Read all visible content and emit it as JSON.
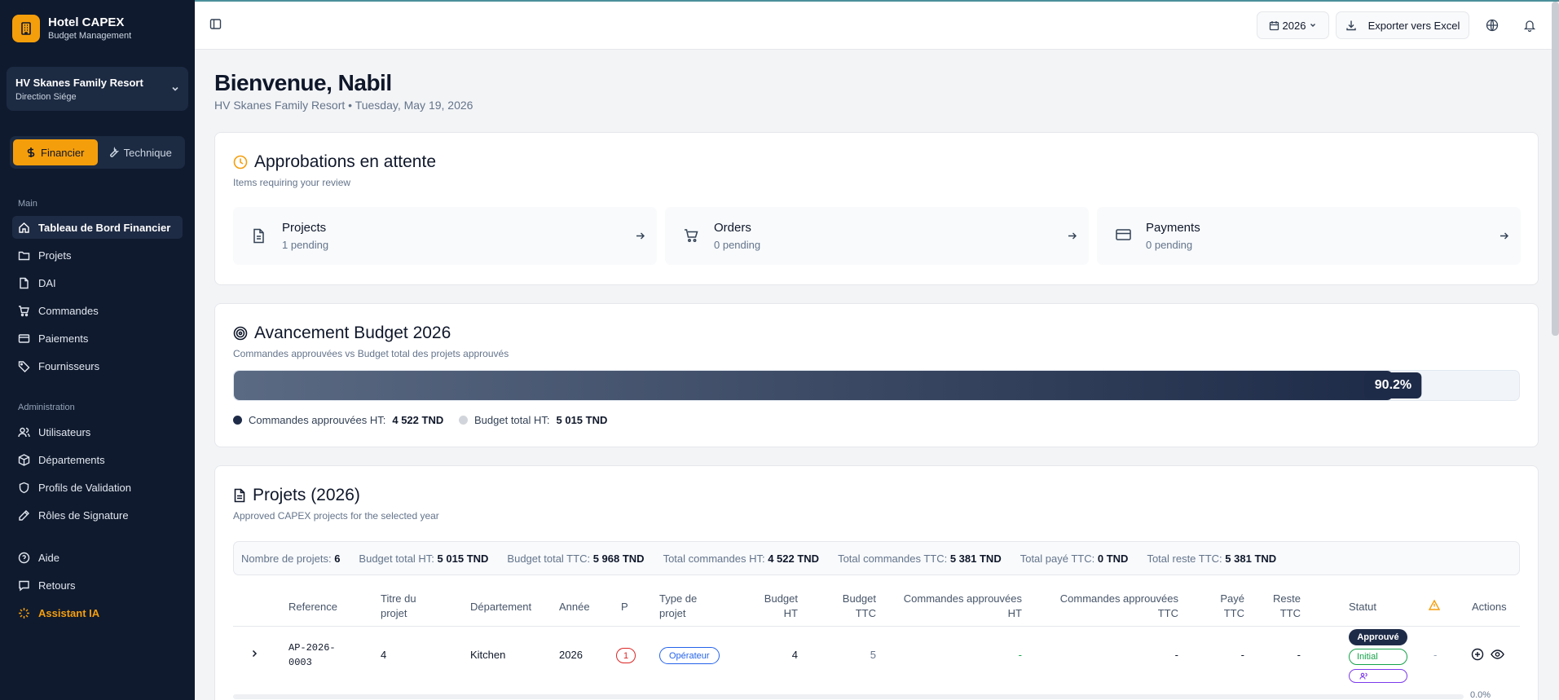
{
  "brand": {
    "title": "Hotel CAPEX",
    "subtitle": "Budget Management"
  },
  "hotel": {
    "name": "HV Skanes Family Resort",
    "sub": "Direction Siége"
  },
  "mode": {
    "financial": "Financier",
    "technical": "Technique"
  },
  "nav": {
    "main_label": "Main",
    "main": [
      "Tableau de Bord Financier",
      "Projets",
      "DAI",
      "Commandes",
      "Paiements",
      "Fournisseurs"
    ],
    "admin_label": "Administration",
    "admin": [
      "Utilisateurs",
      "Départements",
      "Profils de Validation",
      "Rôles de Signature"
    ],
    "help": "Aide",
    "feedback": "Retours",
    "ai": "Assistant IA"
  },
  "topbar": {
    "year": "2026",
    "export_label": "Exporter vers Excel"
  },
  "welcome": {
    "title": "Bienvenue, Nabil",
    "subtitle": "HV Skanes Family Resort • Tuesday, May 19, 2026"
  },
  "approvals": {
    "title": "Approbations en attente",
    "subtitle": "Items requiring your review",
    "items": [
      {
        "label": "Projects",
        "count": "1 pending"
      },
      {
        "label": "Orders",
        "count": "0 pending"
      },
      {
        "label": "Payments",
        "count": "0 pending"
      }
    ]
  },
  "budget": {
    "title": "Avancement Budget 2026",
    "subtitle": "Commandes approuvées vs Budget total des projets approuvés",
    "progress": 0.902,
    "progress_label": "90.2%",
    "legend_approved_label": "Commandes approuvées HT:",
    "legend_approved_value": "4 522 TND",
    "legend_total_label": "Budget total HT:",
    "legend_total_value": "5 015 TND",
    "colors": {
      "approved": "#1e2b48",
      "total": "#d1d5db"
    }
  },
  "projects": {
    "title": "Projets (2026)",
    "subtitle": "Approved CAPEX projects for the selected year",
    "summary": [
      {
        "label": "Nombre de projets:",
        "value": "6"
      },
      {
        "label": "Budget total HT:",
        "value": "5 015 TND"
      },
      {
        "label": "Budget total TTC:",
        "value": "5 968 TND"
      },
      {
        "label": "Total commandes HT:",
        "value": "4 522 TND"
      },
      {
        "label": "Total commandes TTC:",
        "value": "5 381 TND"
      },
      {
        "label": "Total payé TTC:",
        "value": "0 TND"
      },
      {
        "label": "Total reste TTC:",
        "value": "5 381 TND"
      }
    ],
    "columns": {
      "reference": "Reference",
      "title1": "Titre du",
      "title2": "projet",
      "department": "Département",
      "year": "Année",
      "p": "P",
      "type1": "Type de",
      "type2": "projet",
      "budget_ht1": "Budget",
      "budget_ht2": "HT",
      "budget_ttc1": "Budget",
      "budget_ttc2": "TTC",
      "orders_ht1": "Commandes approuvées",
      "orders_ht2": "HT",
      "orders_ttc1": "Commandes approuvées",
      "orders_ttc2": "TTC",
      "paid1": "Payé",
      "paid2": "TTC",
      "rest1": "Reste",
      "rest2": "TTC",
      "status": "Statut",
      "actions": "Actions"
    },
    "row": {
      "reference1": "AP-2026-",
      "reference2": "0003",
      "title": "4",
      "department": "Kitchen",
      "year": "2026",
      "p": "1",
      "type": "Opérateur",
      "budget_ht": "4",
      "budget_ttc": "5",
      "orders_ht": "-",
      "orders_ttc": "-",
      "paid": "-",
      "rest": "-",
      "status_approved": "Approuvé",
      "status_initial": "Initial",
      "warning": "-",
      "percent": "0.0%"
    }
  }
}
